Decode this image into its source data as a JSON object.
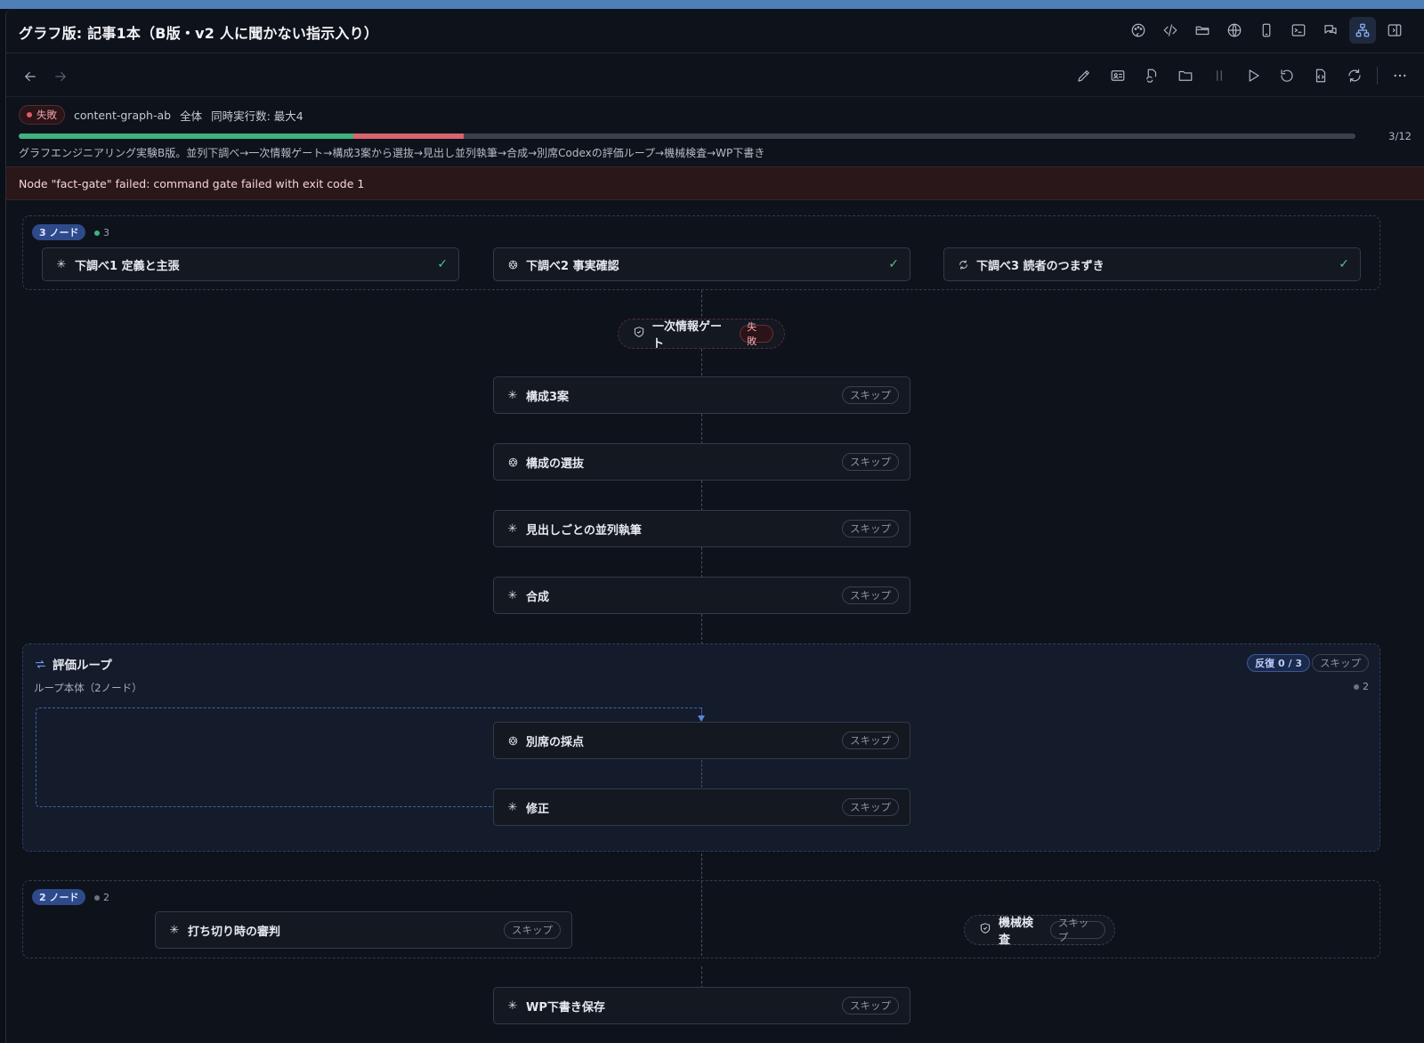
{
  "window": {
    "title": "グラフ版: 記事1本（B版・v2 人に聞かない指示入り）",
    "title_icons": [
      "palette-icon",
      "code-icon",
      "folder-open-icon",
      "globe-icon",
      "phone-icon",
      "terminal-icon",
      "chat-icon",
      "graph-icon",
      "panel-right-icon"
    ]
  },
  "toolbar": {
    "back_icon": "arrow-left-icon",
    "forward_icon": "arrow-right-icon",
    "tools": [
      "edit-icon",
      "id-card-icon",
      "file-sync-icon",
      "folder-icon",
      "pause-icon",
      "play-icon",
      "undo-icon",
      "file-code-icon",
      "refresh-icon",
      "more-icon"
    ]
  },
  "status": {
    "state": "失敗",
    "graph_id": "content-graph-ab",
    "scope": "全体",
    "concurrency": "同時実行数: 最大4",
    "progress_label": "3/12",
    "progress_done": 0.25,
    "progress_failed": 0.083,
    "description": "グラフエンジニアリング実験B版。並列下調べ→一次情報ゲート→構成3案から選抜→見出し並列執筆→合成→別席Codexの評価ループ→機械検査→WP下書き",
    "error": "Node \"fact-gate\" failed: command gate failed with exit code 1"
  },
  "colors": {
    "success": "#3fb27f",
    "failure": "#d8646d",
    "accent": "#2e4a8a"
  },
  "graph": {
    "parallel1": {
      "badge": "3 ノード",
      "count": "3",
      "nodes": [
        {
          "label": "下調べ1 定義と主張",
          "icon": "asterisk-icon",
          "status": "✓"
        },
        {
          "label": "下調べ2 事実確認",
          "icon": "openai-icon",
          "status": "✓"
        },
        {
          "label": "下調べ3 読者のつまずき",
          "icon": "cycle-icon",
          "status": "✓"
        }
      ]
    },
    "gate": {
      "label": "一次情報ゲート",
      "status": "失敗",
      "icon": "shield-icon"
    },
    "sequence": [
      {
        "label": "構成3案",
        "icon": "asterisk-icon",
        "status": "スキップ"
      },
      {
        "label": "構成の選抜",
        "icon": "openai-icon",
        "status": "スキップ"
      },
      {
        "label": "見出しごとの並列執筆",
        "icon": "asterisk-icon",
        "status": "スキップ"
      },
      {
        "label": "合成",
        "icon": "asterisk-icon",
        "status": "スキップ"
      }
    ],
    "loop": {
      "title": "評価ループ",
      "subtitle": "ループ本体（2ノード）",
      "iteration": "反復 0 / 3",
      "status": "スキップ",
      "count": "2",
      "nodes": [
        {
          "label": "別席の採点",
          "icon": "openai-icon",
          "status": "スキップ"
        },
        {
          "label": "修正",
          "icon": "asterisk-icon",
          "status": "スキップ"
        }
      ]
    },
    "parallel2": {
      "badge": "2 ノード",
      "count": "2",
      "node": {
        "label": "打ち切り時の審判",
        "icon": "asterisk-icon",
        "status": "スキップ"
      },
      "gate": {
        "label": "機械検査",
        "icon": "shield-icon",
        "status": "スキップ"
      }
    },
    "final": {
      "label": "WP下書き保存",
      "icon": "asterisk-icon",
      "status": "スキップ"
    }
  }
}
